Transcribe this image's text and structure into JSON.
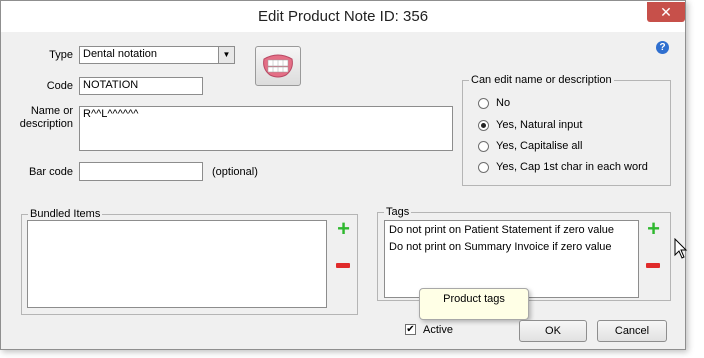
{
  "window": {
    "title": "Edit Product Note    ID: 356",
    "close_glyph": "✕",
    "help_glyph": "?"
  },
  "form": {
    "type_label": "Type",
    "type_value": "Dental notation",
    "code_label": "Code",
    "code_value": "NOTATION",
    "name_label_1": "Name or",
    "name_label_2": "description",
    "name_value": "R^^L^^^^^^",
    "barcode_label": "Bar code",
    "barcode_value": "",
    "barcode_hint": "(optional)"
  },
  "edit_group": {
    "legend": "Can edit name or description",
    "options": [
      {
        "label": "No",
        "selected": false
      },
      {
        "label": "Yes, Natural input",
        "selected": true
      },
      {
        "label": "Yes, Capitalise all",
        "selected": false
      },
      {
        "label": "Yes, Cap 1st char in each word",
        "selected": false
      }
    ]
  },
  "bundled": {
    "legend": "Bundled Items",
    "items": []
  },
  "tags": {
    "legend": "Tags",
    "items": [
      "Do not print on Patient Statement if zero value",
      "Do not print on Summary Invoice if zero value"
    ],
    "tooltip": "Product tags"
  },
  "footer": {
    "active_label": "Active",
    "active_checked": true,
    "ok_label": "OK",
    "cancel_label": "Cancel"
  },
  "colors": {
    "accent": "#c7504a",
    "plus": "#2eb82e",
    "minus": "#e02b2b",
    "help": "#2f6fcf"
  }
}
